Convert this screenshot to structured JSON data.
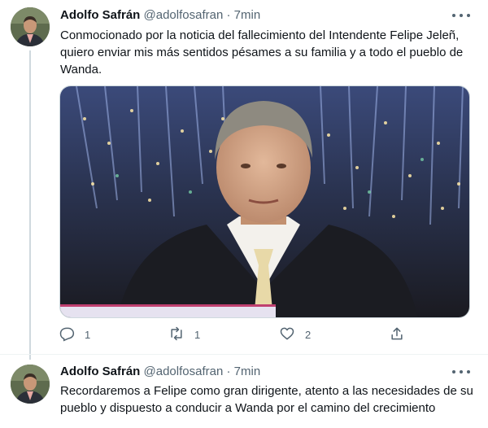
{
  "tweets": [
    {
      "author": {
        "name": "Adolfo Safrán",
        "handle": "@adolfosafran"
      },
      "separator": "·",
      "time": "7min",
      "text": "Conmocionado por la noticia del fallecimiento del Intendente Felipe Jeleñ, quiero enviar mis más sentidos pésames a su familia y a todo el pueblo de Wanda.",
      "stats": {
        "replies": "1",
        "retweets": "1",
        "likes": "2"
      }
    },
    {
      "author": {
        "name": "Adolfo Safrán",
        "handle": "@adolfosafran"
      },
      "separator": "·",
      "time": "7min",
      "text": "Recordaremos a Felipe como gran dirigente, atento a las necesidades de su pueblo y dispuesto a conducir a Wanda por el camino del crecimiento"
    }
  ],
  "icons": {
    "reply": "reply-icon",
    "retweet": "retweet-icon",
    "like": "heart-icon",
    "share": "share-icon",
    "more": "more-options-icon"
  },
  "colors": {
    "text": "#0f1419",
    "secondary": "#536471",
    "divider": "#eff3f4",
    "thread_line": "#cfd9de"
  }
}
